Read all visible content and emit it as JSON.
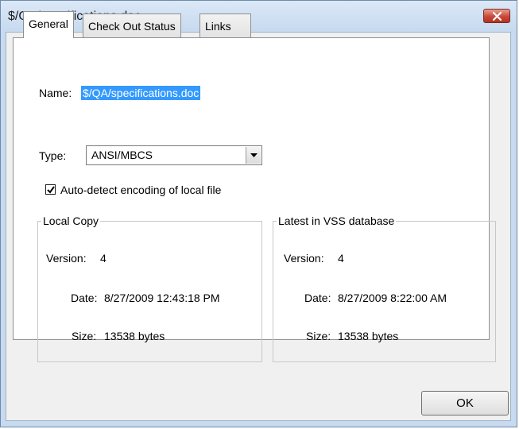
{
  "window": {
    "title": "$/QA/specifications.doc",
    "close_icon": "close-icon"
  },
  "tabs": [
    {
      "label": "General",
      "active": true
    },
    {
      "label": "Check Out Status",
      "active": false
    },
    {
      "label": "Links",
      "active": false
    }
  ],
  "general": {
    "name_label": "Name:",
    "name_value": "$/QA/specifications.doc",
    "type_label": "Type:",
    "type_selected": "ANSI/MBCS",
    "autodetect_label": "Auto-detect encoding of local file",
    "autodetect_checked": true
  },
  "local_copy": {
    "title": "Local Copy",
    "version_label": "Version:",
    "version_value": "4",
    "date_label": "Date:",
    "date_value": "8/27/2009 12:43:18 PM",
    "size_label": "Size:",
    "size_value": "13538 bytes"
  },
  "latest_vss": {
    "title": "Latest in VSS database",
    "version_label": "Version:",
    "version_value": "4",
    "date_label": "Date:",
    "date_value": "8/27/2009 8:22:00 AM",
    "size_label": "Size:",
    "size_value": "13538 bytes"
  },
  "buttons": {
    "ok_label": "OK"
  }
}
